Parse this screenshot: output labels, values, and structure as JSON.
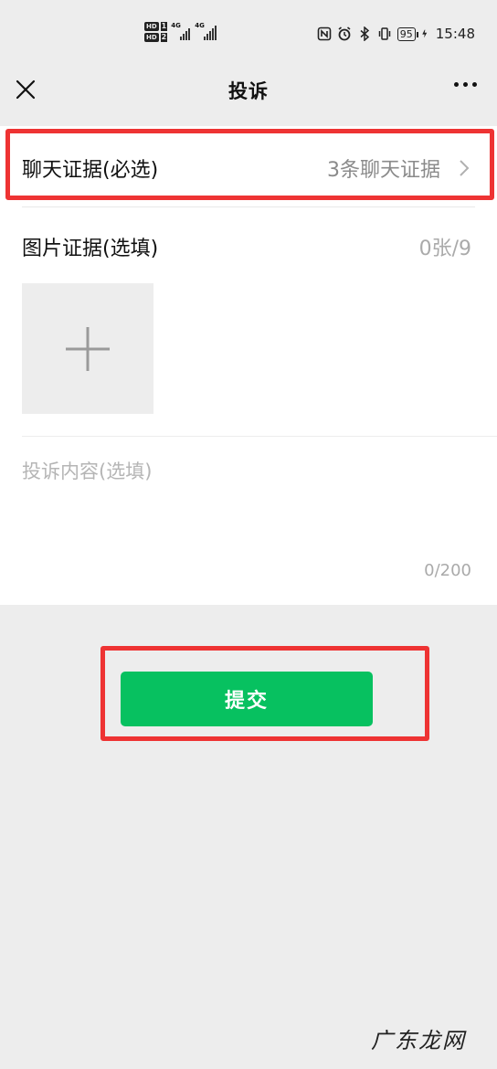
{
  "status_bar": {
    "hd1": "HD",
    "hd1_num": "1",
    "hd2": "HD",
    "hd2_num": "2",
    "net1": "4G",
    "net2": "4G",
    "battery": "95",
    "time": "15:48"
  },
  "nav": {
    "title": "投诉"
  },
  "chat_evidence": {
    "label": "聊天证据(必选)",
    "value": "3条聊天证据"
  },
  "image_evidence": {
    "label": "图片证据(选填)",
    "count": "0张/9"
  },
  "complaint": {
    "placeholder": "投诉内容(选填)",
    "value": "",
    "counter": "0/200"
  },
  "submit": {
    "label": "提交"
  },
  "watermark": "广东龙网",
  "colors": {
    "accent": "#07c160",
    "highlight": "#ee3333",
    "background": "#ededed"
  }
}
